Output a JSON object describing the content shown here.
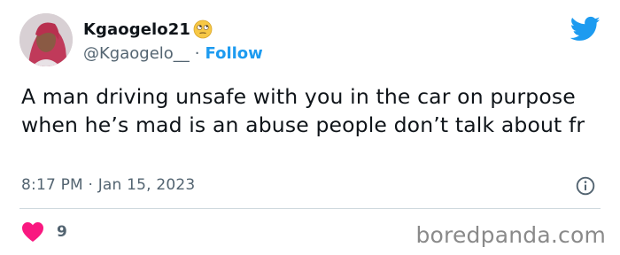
{
  "author": {
    "display_name": "Kgaogelo21",
    "handle": "@Kgaogelo__",
    "separator": "·",
    "follow_label": "Follow"
  },
  "tweet": {
    "text": "A man driving unsafe with you in the car on purpose when he’s mad is an abuse people don’t talk about fr",
    "timestamp": "8:17 PM · Jan 15, 2023"
  },
  "engagement": {
    "likes": "9"
  },
  "watermark": "boredpanda.com",
  "icons": {
    "platform": "twitter-bird-icon",
    "emoji": "rolling-eyes-emoji-icon",
    "info": "info-icon",
    "like": "heart-icon"
  },
  "colors": {
    "accent": "#1d9bf0",
    "like": "#f91880",
    "secondary_text": "#536471"
  }
}
